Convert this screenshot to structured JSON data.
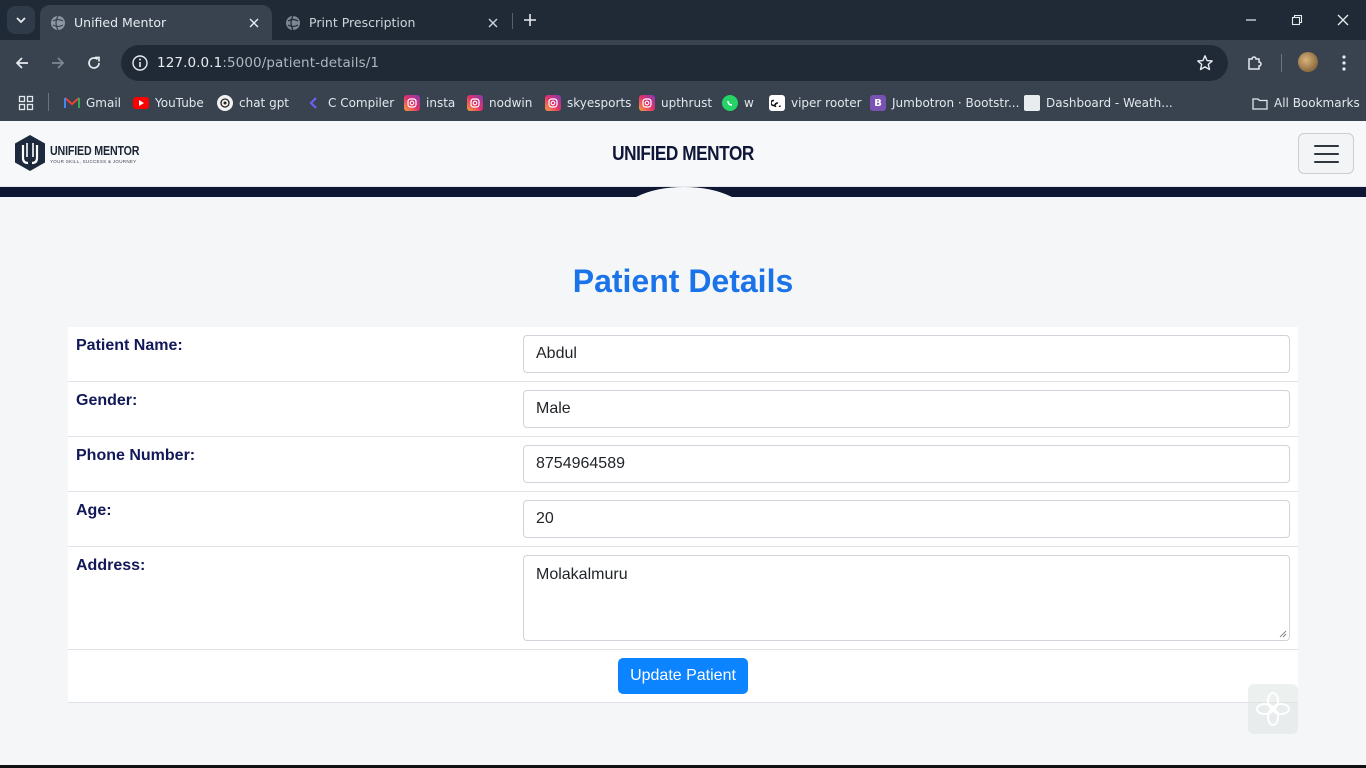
{
  "browser": {
    "tabs": [
      {
        "title": "Unified Mentor",
        "active": true
      },
      {
        "title": "Print Prescription",
        "active": false
      }
    ],
    "url": {
      "host": "127.0.0.1",
      "path": ":5000/patient-details/1"
    },
    "bookmarks": [
      {
        "label": "Gmail",
        "icon": "gmail-icon"
      },
      {
        "label": "YouTube",
        "icon": "youtube-icon"
      },
      {
        "label": "chat gpt",
        "icon": "chatgpt-icon"
      },
      {
        "label": "C Compiler",
        "icon": "compiler-icon"
      },
      {
        "label": "insta",
        "icon": "instagram-icon"
      },
      {
        "label": "nodwin",
        "icon": "instagram-icon"
      },
      {
        "label": "skyesports",
        "icon": "instagram-icon"
      },
      {
        "label": "upthrust",
        "icon": "instagram-icon"
      },
      {
        "label": "w",
        "icon": "whatsapp-icon"
      },
      {
        "label": "viper rooter",
        "icon": "link-icon"
      },
      {
        "label": "Jumbotron · Bootstr...",
        "icon": "bootstrap-icon"
      },
      {
        "label": "Dashboard - Weath...",
        "icon": "page-icon"
      }
    ],
    "all_bookmarks_label": "All Bookmarks"
  },
  "site": {
    "logo_text": "UNIFIED MENTOR",
    "logo_tagline": "YOUR SKILL, SUCCESS & JOURNEY",
    "title": "UNIFIED MENTOR"
  },
  "page": {
    "heading": "Patient Details",
    "fields": [
      {
        "label": "Patient Name:",
        "value": "Abdul"
      },
      {
        "label": "Gender:",
        "value": "Male"
      },
      {
        "label": "Phone Number:",
        "value": "8754964589"
      },
      {
        "label": "Age:",
        "value": "20"
      },
      {
        "label": "Address:",
        "value": "Molakalmuru"
      }
    ],
    "submit_label": "Update Patient"
  },
  "colors": {
    "heading": "#1a73e8",
    "label": "#121858",
    "button": "#0d84ff",
    "header_band": "#0f1733",
    "browser_frame": "#1f2a36"
  }
}
